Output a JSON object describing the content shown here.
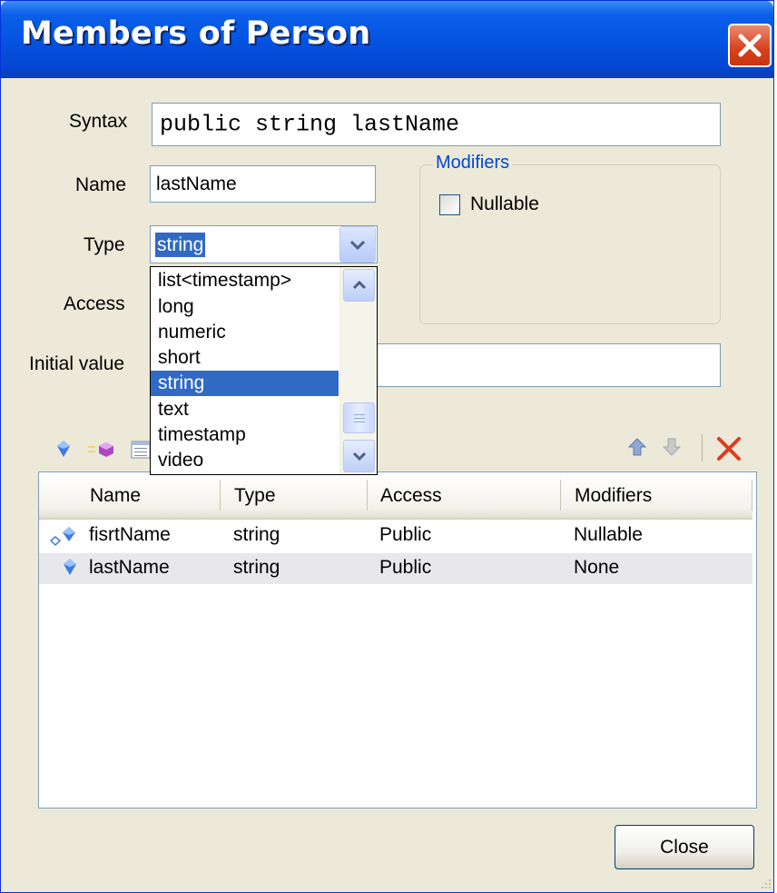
{
  "window": {
    "title": "Members of Person"
  },
  "form": {
    "syntax_label": "Syntax",
    "syntax_value": "public string lastName",
    "name_label": "Name",
    "name_value": "lastName",
    "type_label": "Type",
    "type_value": "string",
    "access_label": "Access",
    "initial_value_label": "Initial value",
    "initial_value": ""
  },
  "modifiers": {
    "legend": "Modifiers",
    "nullable_label": "Nullable",
    "nullable_checked": false
  },
  "type_dropdown": {
    "options": [
      "list<timestamp>",
      "long",
      "numeric",
      "short",
      "string",
      "text",
      "timestamp",
      "video"
    ],
    "selected": "string"
  },
  "toolbar": {
    "icons": [
      "add-member-icon",
      "add-method-icon",
      "list-view-icon",
      "move-up-icon",
      "move-down-icon",
      "delete-icon"
    ]
  },
  "members_table": {
    "columns": [
      "Name",
      "Type",
      "Access",
      "Modifiers"
    ],
    "rows": [
      {
        "name": "fisrtName",
        "type": "string",
        "access": "Public",
        "modifiers": "Nullable"
      },
      {
        "name": "lastName",
        "type": "string",
        "access": "Public",
        "modifiers": "None"
      }
    ],
    "selected_row": "lastName"
  },
  "buttons": {
    "close_label": "Close"
  },
  "colors": {
    "titlebar": "#0554e3",
    "selection": "#316ac5",
    "close_x": "#e03b1f",
    "group_legend": "#0046d5"
  }
}
